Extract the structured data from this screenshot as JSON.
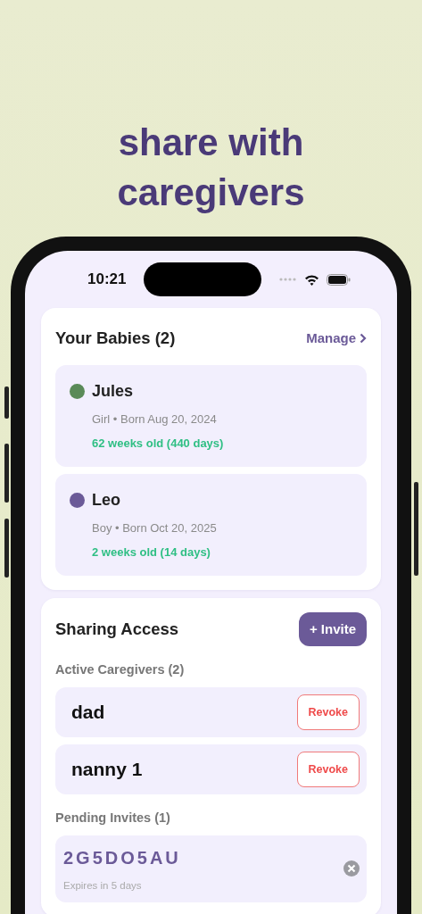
{
  "headline": "share with caregivers",
  "status_bar": {
    "time": "10:21"
  },
  "babies": {
    "title": "Your Babies (2)",
    "manage_link": "Manage",
    "items": [
      {
        "name": "Jules",
        "color": "#5a8a58",
        "details": "Girl • Born Aug 20, 2024",
        "age": "62 weeks old (440 days)"
      },
      {
        "name": "Leo",
        "color": "#6b5a98",
        "details": "Boy • Born Oct 20, 2025",
        "age": "2 weeks old (14 days)"
      }
    ]
  },
  "sharing": {
    "title": "Sharing Access",
    "invite_button": "+ Invite",
    "active_label": "Active Caregivers (2)",
    "caregivers": [
      {
        "name": "dad",
        "action": "Revoke"
      },
      {
        "name": "nanny 1",
        "action": "Revoke"
      }
    ],
    "pending_label": "Pending Invites (1)",
    "invites": [
      {
        "code": "2G5DO5AU",
        "expires": "Expires in 5 days"
      }
    ]
  }
}
